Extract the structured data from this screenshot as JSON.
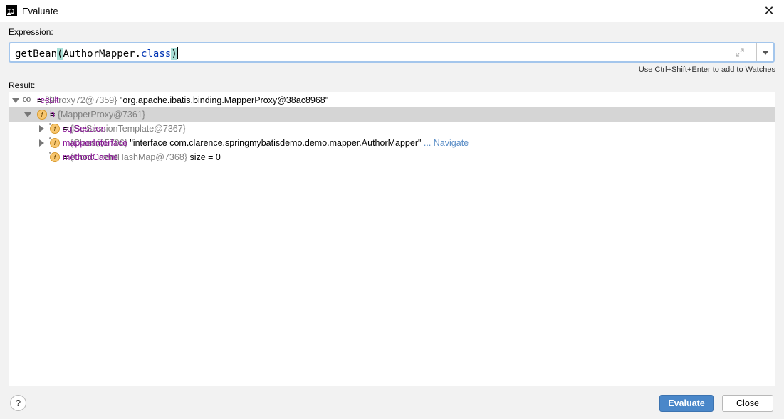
{
  "window": {
    "title": "Evaluate",
    "app_icon": "intellij-icon",
    "close_icon": "close-icon"
  },
  "expression": {
    "label": "Expression:",
    "parts": {
      "fn": "getBean",
      "open": "(",
      "arg": "AuthorMapper.",
      "kw": "class",
      "close": ")"
    },
    "expand_icon": "expand-icon",
    "dropdown_icon": "chevron-down-icon",
    "hint": "Use Ctrl+Shift+Enter to add to Watches"
  },
  "result": {
    "label": "Result:",
    "tree": [
      {
        "name": "result",
        "sep": " = ",
        "ref": "{$Proxy72@7359}",
        "value": " \"org.apache.ibatis.binding.MapperProxy@38ac8968\"",
        "icon": "watch-glasses-icon",
        "expanded": true
      },
      {
        "name": "h",
        "sep": " = ",
        "ref": "{MapperProxy@7361}",
        "value": "",
        "icon": "field-icon",
        "expanded": true,
        "selected": true
      },
      {
        "name": "sqlSession",
        "sep": " = ",
        "ref": "{SqlSessionTemplate@7367}",
        "value": "",
        "icon": "field-icon",
        "expanded": false
      },
      {
        "name": "mapperInterface",
        "sep": " = ",
        "ref": "{Class@5796}",
        "value": " \"interface com.clarence.springmybatisdemo.demo.mapper.AuthorMapper\"",
        "link": " ... Navigate",
        "icon": "field-icon",
        "expanded": false
      },
      {
        "name": "methodCache",
        "sep": " = ",
        "ref": "{ConcurrentHashMap@7368}",
        "value": "  size = 0",
        "icon": "field-icon",
        "expanded": null
      }
    ]
  },
  "footer": {
    "help_label": "?",
    "evaluate_label": "Evaluate",
    "close_label": "Close"
  },
  "colors": {
    "accent": "#4a87c9",
    "field_name": "#871094",
    "link": "#5b8ec7",
    "selection": "#d5d5d5"
  }
}
